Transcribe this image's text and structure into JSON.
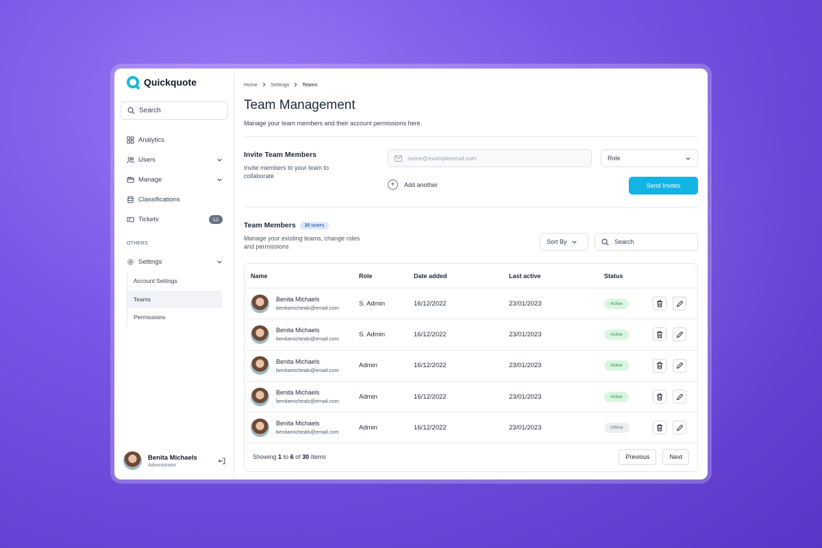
{
  "app": {
    "name": "Quickquote",
    "accent": "#14b8d8"
  },
  "sidebar": {
    "search_label": "Search",
    "items": [
      {
        "label": "Analytics",
        "icon": "grid-icon"
      },
      {
        "label": "Users",
        "icon": "users-icon"
      },
      {
        "label": "Manage",
        "icon": "folder-icon"
      },
      {
        "label": "Classifications",
        "icon": "database-icon"
      },
      {
        "label": "Tickets",
        "icon": "ticket-icon",
        "count": "12"
      }
    ],
    "section_label": "OTHERS",
    "settings_label": "Settings",
    "sub_items": [
      "Account Settings",
      "Teams",
      "Permissions"
    ],
    "user": {
      "name": "Benita Michaels",
      "role": "Administrator"
    }
  },
  "breadcrumb": [
    "Home",
    "Settings",
    "Teams"
  ],
  "page": {
    "title": "Team Management",
    "subtitle": "Manage your team members and their account permissions here."
  },
  "invite": {
    "title": "Invite Team Members",
    "description": "Invite members to your team to collaborate",
    "email_placeholder": "name@exampleemail.com",
    "role_label": "Role",
    "add_another_label": "Add another",
    "send_label": "Send Invites",
    "send_color": "#12b4e3"
  },
  "members": {
    "title": "Team Members",
    "count_badge": "30 users",
    "description": "Manage your existing teams, change roles and permissions",
    "sort_label": "Sort By",
    "search_label": "Search",
    "columns": [
      "Name",
      "Role",
      "Date added",
      "Last active",
      "Status"
    ],
    "rows": [
      {
        "name": "Benita Michaels",
        "email": "benitamicheals@email.com",
        "role": "S. Admin",
        "added": "16/12/2022",
        "last": "23/01/2023",
        "status": "Active"
      },
      {
        "name": "Benita Michaels",
        "email": "benitamicheals@email.com",
        "role": "S. Admin",
        "added": "16/12/2022",
        "last": "23/01/2023",
        "status": "Active"
      },
      {
        "name": "Benita Michaels",
        "email": "benitamicheals@email.com",
        "role": "Admin",
        "added": "16/12/2022",
        "last": "23/01/2023",
        "status": "Active"
      },
      {
        "name": "Benita Michaels",
        "email": "benitamicheals@email.com",
        "role": "Admin",
        "added": "16/12/2022",
        "last": "23/01/2023",
        "status": "Active"
      },
      {
        "name": "Benita Michaels",
        "email": "benitamicheals@email.com",
        "role": "Admin",
        "added": "16/12/2022",
        "last": "23/01/2023",
        "status": "Offline"
      }
    ],
    "footer": {
      "showing": "Showing",
      "from": "1",
      "to_word": "to",
      "to": "6",
      "of_word": "of",
      "total": "30",
      "items_word": "Items"
    },
    "prev_label": "Previous",
    "next_label": "Next"
  }
}
